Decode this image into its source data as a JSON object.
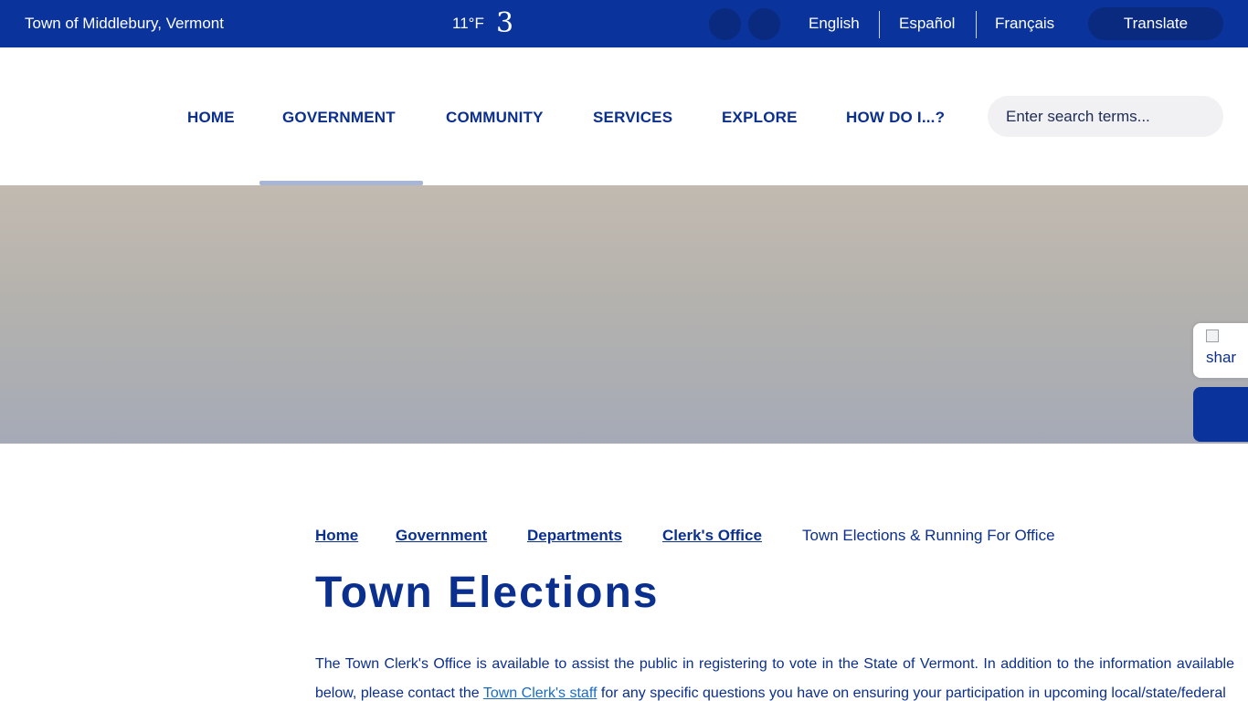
{
  "topbar": {
    "town_name": "Town of Middlebury, Vermont",
    "temperature": "11°F",
    "weather_icon_glyph": "3",
    "languages": [
      "English",
      "Español",
      "Français"
    ],
    "translate_label": "Translate",
    "background_color": "#0a339b"
  },
  "nav": {
    "items": [
      "HOME",
      "GOVERNMENT",
      "COMMUNITY",
      "SERVICES",
      "EXPLORE",
      "HOW DO I...?"
    ],
    "active_item": "GOVERNMENT",
    "search_placeholder": "Enter search terms..."
  },
  "side_tabs": {
    "share_alt_text": "shar"
  },
  "breadcrumb": {
    "links": [
      "Home",
      "Government",
      "Departments",
      "Clerk's Office"
    ],
    "current": "Town Elections & Running For Office"
  },
  "page": {
    "title": "Town Elections",
    "intro_before_link": "The Town Clerk's Office is available to assist the public in registering to vote in the State of Vermont. In addition to the information available below, please contact the ",
    "intro_link": "Town Clerk's staff",
    "intro_after_link": " for any specific questions you have on ensuring your participation in upcoming local/state/federal"
  },
  "colors": {
    "brand_blue": "#0a339b",
    "text_blue": "#0b2f8f",
    "link_blue": "#1a6bc4"
  }
}
